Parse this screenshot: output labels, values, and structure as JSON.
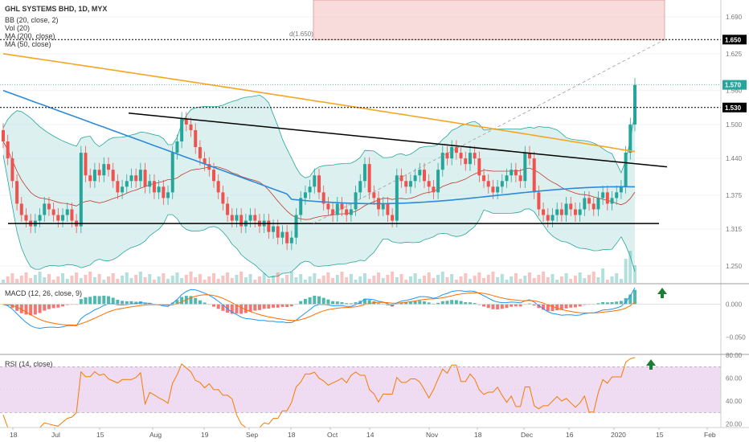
{
  "header": {
    "title": "GHL SYSTEMS BHD, 1D, MYX",
    "indicators": [
      "BB (20, close, 2)",
      "Vol (20)",
      "MA (200, close)",
      "MA (50, close)"
    ]
  },
  "macd_panel": {
    "label": "MACD (12, 26, close, 9)",
    "ticks": [
      "0.000",
      "−0.050"
    ]
  },
  "rsi_panel": {
    "label": "RSI (14, close)",
    "ticks": [
      "80.00",
      "60.00",
      "40.00",
      "20.00"
    ]
  },
  "price_axis": {
    "ticks": [
      "1.690",
      "1.625",
      "1.560",
      "1.500",
      "1.440",
      "1.375",
      "1.315",
      "1.250"
    ],
    "highlight_tags": [
      {
        "value": "1.650",
        "bg": "#000000",
        "fg": "#ffffff"
      },
      {
        "value": "1.570",
        "bg": "#26a69a",
        "fg": "#ffffff"
      },
      {
        "value": "1.530",
        "bg": "#000000",
        "fg": "#ffffff"
      }
    ]
  },
  "annotation": {
    "target_label": "d(1.650)"
  },
  "time_axis": [
    "18",
    "Jul",
    "15",
    "Aug",
    "19",
    "Sep",
    "18",
    "Oct",
    "14",
    "Nov",
    "18",
    "Dec",
    "16",
    "2020",
    "15",
    "Feb"
  ],
  "colors": {
    "up": "#26a69a",
    "down": "#ef5350",
    "ma200": "#f5a623",
    "ma50": "#2d8ad8",
    "bb_fill": "#b2dfdb",
    "target_zone": "#f4c7c7"
  },
  "chart_data": {
    "type": "candlestick",
    "title": "GHL SYSTEMS BHD, 1D, MYX",
    "timeframe": "1D",
    "ylim": [
      1.22,
      1.72
    ],
    "horizontal_levels": [
      1.65,
      1.57,
      1.53,
      1.325
    ],
    "trendline_descending": {
      "from_price": 1.52,
      "to_price": 1.425
    },
    "support_line": 1.325,
    "series_close": [
      1.47,
      1.44,
      1.4,
      1.36,
      1.34,
      1.33,
      1.32,
      1.33,
      1.34,
      1.36,
      1.35,
      1.34,
      1.33,
      1.34,
      1.35,
      1.33,
      1.32,
      1.45,
      1.41,
      1.4,
      1.42,
      1.41,
      1.43,
      1.42,
      1.4,
      1.38,
      1.39,
      1.4,
      1.41,
      1.4,
      1.42,
      1.39,
      1.4,
      1.38,
      1.39,
      1.37,
      1.38,
      1.45,
      1.47,
      1.51,
      1.5,
      1.49,
      1.46,
      1.44,
      1.43,
      1.42,
      1.4,
      1.38,
      1.36,
      1.34,
      1.33,
      1.34,
      1.32,
      1.33,
      1.34,
      1.33,
      1.32,
      1.33,
      1.31,
      1.32,
      1.3,
      1.31,
      1.29,
      1.3,
      1.34,
      1.37,
      1.38,
      1.39,
      1.41,
      1.38,
      1.36,
      1.35,
      1.34,
      1.36,
      1.35,
      1.34,
      1.35,
      1.38,
      1.4,
      1.43,
      1.38,
      1.37,
      1.35,
      1.36,
      1.34,
      1.33,
      1.41,
      1.4,
      1.39,
      1.4,
      1.41,
      1.42,
      1.4,
      1.39,
      1.38,
      1.42,
      1.45,
      1.44,
      1.46,
      1.45,
      1.44,
      1.43,
      1.45,
      1.44,
      1.41,
      1.4,
      1.39,
      1.38,
      1.39,
      1.4,
      1.41,
      1.42,
      1.41,
      1.4,
      1.45,
      1.44,
      1.38,
      1.35,
      1.34,
      1.33,
      1.34,
      1.35,
      1.34,
      1.36,
      1.35,
      1.34,
      1.35,
      1.37,
      1.36,
      1.35,
      1.37,
      1.38,
      1.36,
      1.37,
      1.38,
      1.39,
      1.45,
      1.5,
      1.57
    ],
    "ma200": {
      "start": 1.625,
      "end": 1.452
    },
    "ma50": {
      "start": 1.56,
      "end": 1.375
    },
    "macd": {
      "zero_line": 0.0,
      "range": [
        -0.075,
        0.03
      ]
    },
    "rsi": {
      "range": [
        17,
        80
      ],
      "band": [
        30,
        70
      ],
      "last": 78
    }
  }
}
